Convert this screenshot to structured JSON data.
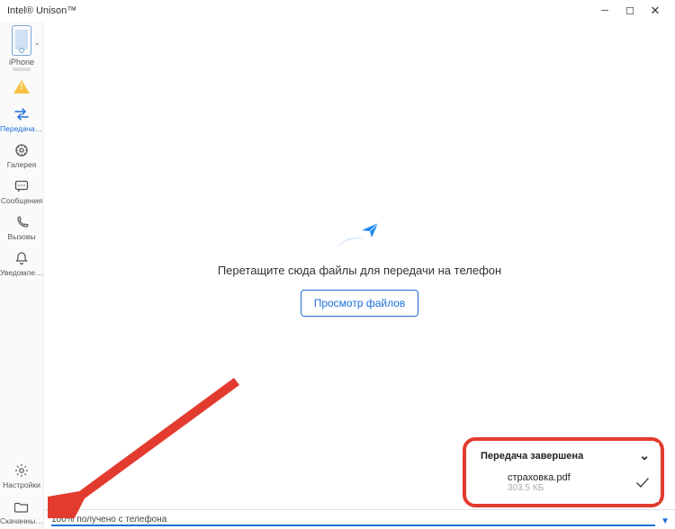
{
  "window": {
    "title": "Intel® Unison™"
  },
  "device": {
    "name": "iPhone"
  },
  "sidebar": {
    "items": [
      {
        "label": "Передача ...",
        "icon": "transfer-icon"
      },
      {
        "label": "Галерея",
        "icon": "gallery-icon"
      },
      {
        "label": "Сообщения",
        "icon": "messages-icon"
      },
      {
        "label": "Вызовы",
        "icon": "calls-icon"
      },
      {
        "label": "Уведомлен...",
        "icon": "bell-icon"
      }
    ],
    "bottom": [
      {
        "label": "Настройки",
        "icon": "gear-icon"
      },
      {
        "label": "Скачанные...",
        "icon": "folder-icon"
      }
    ]
  },
  "main": {
    "drop_hint": "Перетащите сюда файлы для передачи на телефон",
    "browse_label": "Просмотр файлов"
  },
  "toast": {
    "title": "Передача завершена",
    "file_name": "страховка.pdf",
    "file_size": "303.5 КБ"
  },
  "status": {
    "text": "100% получено с телефона"
  }
}
